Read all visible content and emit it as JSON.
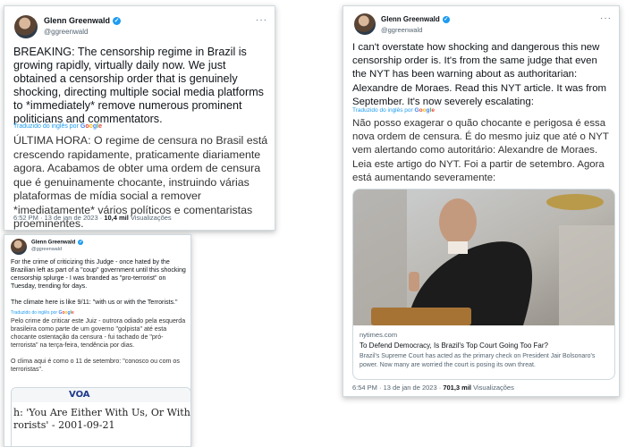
{
  "accent_color": "#1d9bf0",
  "author": {
    "name": "Glenn Greenwald",
    "handle": "@ggreenwald",
    "verified_icon": "verified-badge-icon"
  },
  "translated_label": "Traduzido do inglês por",
  "translated_brand": [
    "G",
    "o",
    "o",
    "g",
    "l",
    "e"
  ],
  "tweet1": {
    "text_en": "BREAKING: The censorship regime in Brazil is growing rapidly, virtually daily now. We just obtained a censorship order that is genuinely shocking, directing multiple social media platforms to *immediately* remove numerous prominent politicians and commentators.",
    "text_pt": "ÚLTIMA HORA: O regime de censura no Brasil está crescendo rapidamente, praticamente diariamente agora. Acabamos de obter uma ordem de censura que é genuinamente chocante, instruindo várias plataformas de mídia social a remover *imediatamente* vários políticos e comentaristas proeminentes.",
    "timestamp": "6:52 PM · 13 de jan de 2023 · ",
    "views_count": "10,4 mil",
    "views_label": " Visualizações"
  },
  "tweet2": {
    "text_en": "For the crime of criticizing this Judge - once hated by the Brazilian left as part of a \"coup\" government until this shocking censorship splurge - I was branded as \"pro-terrorist\" on Tuesday, trending for days.\n\nThe climate here is like 9/11: \"with us or with the Terrorists.\"",
    "text_pt": "Pelo crime de criticar este Juiz - outrora odiado pela esquerda brasileira como parte de um governo \"golpista\" até esta chocante ostentação da censura - fui tachado de \"pró-terrorista\" na terça-feira, tendência por dias.\n\nO clima aqui é como o 11 de setembro: \"conosco ou com os terroristas\".",
    "link": {
      "logo": "VOA",
      "headline": "h: 'You Are Either With Us, Or With t\nrorists' - 2001-09-21"
    }
  },
  "tweet3": {
    "text_en": "I can't overstate how shocking and dangerous this new censorship order is. It's from the same judge that even the NYT has been warning about as authoritarian: Alexandre de Moraes. Read this NYT article. It was from September. It's now severely escalating:",
    "text_pt": "Não posso exagerar o quão chocante e perigosa é essa nova ordem de censura. É do mesmo juiz que até o NYT vem alertando como autoritário: Alexandre de Moraes. Leia este artigo do NYT. Foi a partir de setembro. Agora está aumentando severamente:",
    "link": {
      "domain": "nytimes.com",
      "title": "To Defend Democracy, Is Brazil's Top Court Going Too Far?",
      "description": "Brazil's Supreme Court has acted as the primary check on President Jair Bolsonaro's power. Now many are worried the court is posing its own threat."
    },
    "timestamp": "6:54 PM · 13 de jan de 2023 · ",
    "views_count": "701,3 mil",
    "views_label": " Visualizações"
  }
}
